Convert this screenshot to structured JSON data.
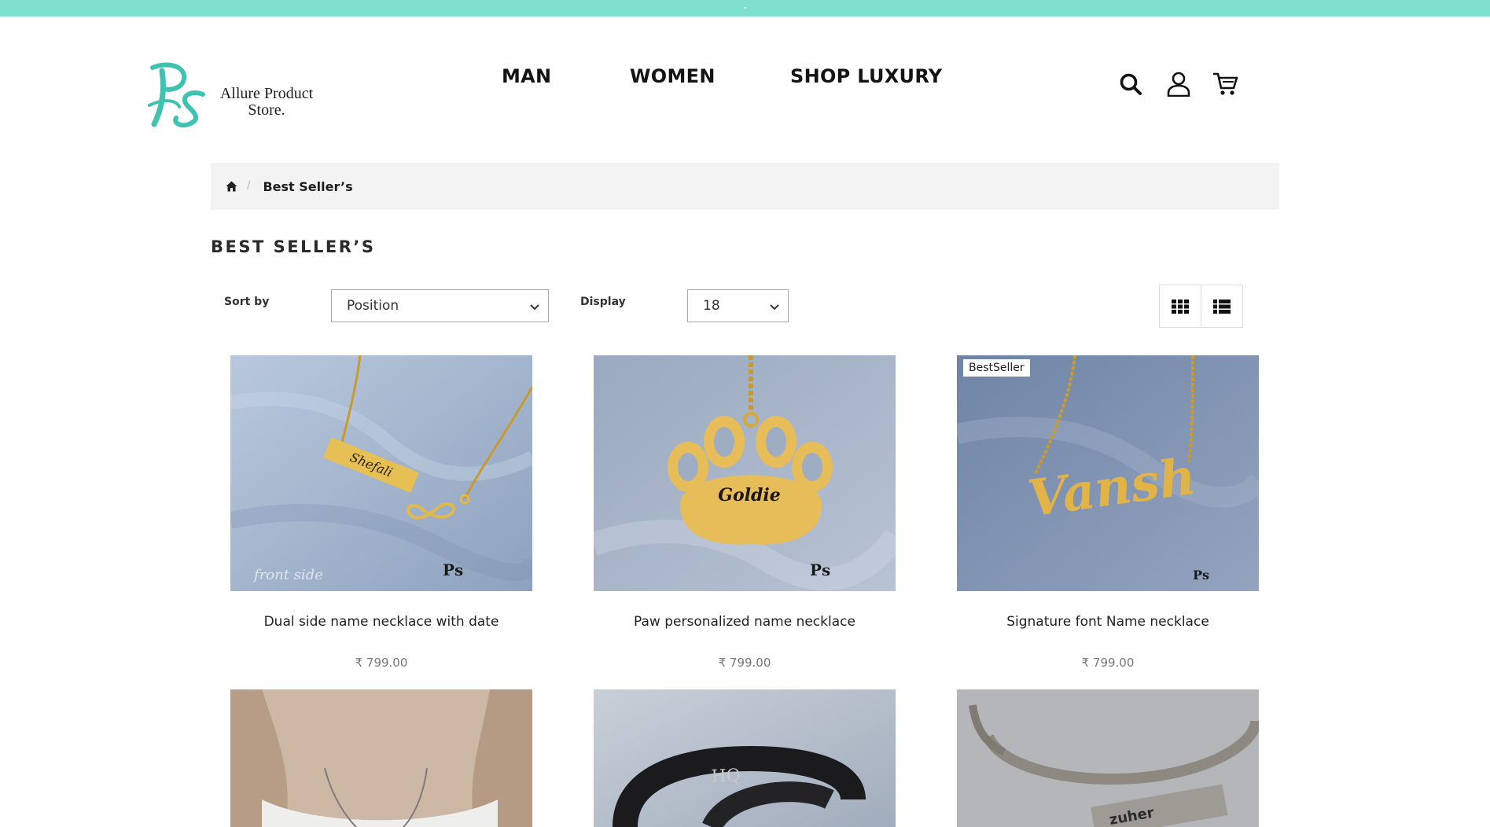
{
  "brand": {
    "name_line1": "Allure Product",
    "name_line2": "Store.",
    "accent_color": "#7ee0cf",
    "logo_color": "#3fc3b0"
  },
  "nav": {
    "items": [
      {
        "label": "MAN"
      },
      {
        "label": "WOMEN"
      },
      {
        "label": "SHOP LUXURY"
      }
    ]
  },
  "header_icons": [
    "search-icon",
    "user-icon",
    "cart-icon"
  ],
  "breadcrumb": {
    "home_icon": "home-icon",
    "current": "Best Seller’s"
  },
  "page": {
    "title": "BEST SELLER’S"
  },
  "toolbar": {
    "sort_label": "Sort by",
    "sort_value": "Position",
    "display_label": "Display",
    "display_value": "18",
    "view_modes": [
      "grid-view-icon",
      "list-view-icon"
    ]
  },
  "products": [
    {
      "name": "Dual side name necklace with date",
      "price": "₹ 799.00",
      "badge": ""
    },
    {
      "name": "Paw personalized name necklace",
      "price": "₹ 799.00",
      "badge": ""
    },
    {
      "name": "Signature font Name necklace",
      "price": "₹ 799.00",
      "badge": "BestSeller"
    },
    {
      "name": "",
      "price": "",
      "badge": ""
    },
    {
      "name": "",
      "price": "",
      "badge": ""
    },
    {
      "name": "",
      "price": "",
      "badge": ""
    }
  ],
  "image_text": {
    "p1_engraving": "Shefali",
    "p2_engraving": "Goldie",
    "p3_engraving": "Vansh",
    "p5_engraving": "HQ",
    "p6_engraving": "zuher"
  }
}
